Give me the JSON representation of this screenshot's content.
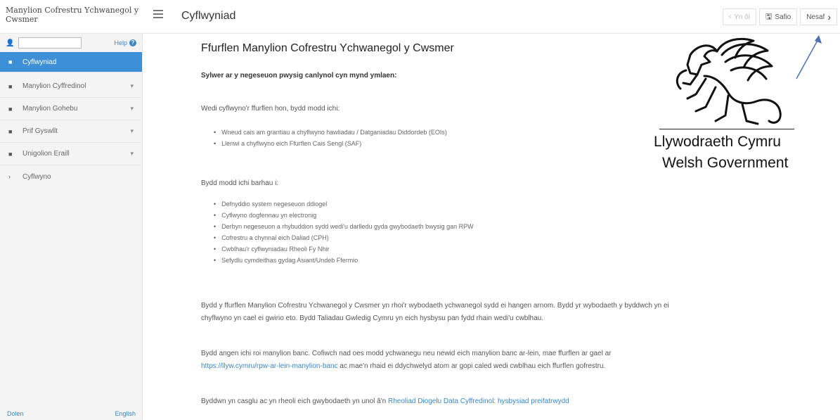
{
  "app": {
    "title": "Manylion Cofrestru Ychwanegol y Cwsmer",
    "page_heading": "Cyflwyniad"
  },
  "toolbar": {
    "prev_label": "Yn ôl",
    "save_label": "Safio",
    "next_label": "Nesaf"
  },
  "sidebar": {
    "user_value": "",
    "help_label": "Help",
    "items": [
      {
        "label": "Cyflwyniad",
        "icon": "file-icon",
        "active": true
      },
      {
        "label": "Manylion Cyffredinol",
        "icon": "file-icon",
        "expandable": true
      },
      {
        "label": "Manylion Gohebu",
        "icon": "file-icon",
        "expandable": true
      },
      {
        "label": "Prif Gyswllt",
        "icon": "file-icon",
        "expandable": true
      },
      {
        "label": "Unigolion Eraill",
        "icon": "file-icon",
        "expandable": true
      },
      {
        "label": "Cyflwyno",
        "icon": "chevron-right-icon"
      }
    ],
    "footer_left": "Dolen",
    "footer_right": "English"
  },
  "content": {
    "form_title": "Ffurflen Manylion Cofrestru Ychwanegol y Cwsmer",
    "notice": "Sylwer ar y negeseuon pwysig canlynol cyn mynd ymlaen:",
    "intro1": "Wedi cyflwyno'r ffurflen hon, bydd modd ichi:",
    "list1": [
      "Wneud cais am grantiau a chyflwyno hawliadau / Datganiadau Diddordeb (EOIs)",
      "Llenwi a chyflwyno eich Ffurflen Cais Sengl (SAF)"
    ],
    "intro2": "Bydd modd ichi barhau i:",
    "list2": [
      "Defnyddio system negeseuon ddiogel",
      "Cyflwyno dogfennau yn electronig",
      "Derbyn negeseuon a rhybuddion sydd wedi'u darlledu gyda gwybodaeth bwysig gan RPW",
      "Cofrestru a chynnal eich Daliad (CPH)",
      "Cwblhau'r cyflwyniadau Rheoli Fy Nhir",
      "Sefydlu cymdeithas gydag Asiant/Undeb Ffermio"
    ],
    "para1_line1": "Bydd y ffurflen Manylion Cofrestru Ychwanegol y Cwsmer yn rhoi'r wybodaeth ychwanegol sydd ei hangen arnom. Bydd yr wybodaeth y byddwch yn ei",
    "para1_line2": "chyflwyno yn cael ei gwirio eto. Bydd Taliadau Gwledig Cymru yn eich hysbysu pan fydd rhain wedi'u cwblhau.",
    "para2_line1": "Bydd angen ichi roi manylion banc. Cofiwch nad oes modd ychwanegu neu newid eich manylion banc ar-lein, mae ffurflen ar gael ar",
    "para2_link": "https://llyw.cymru/rpw-ar-lein-manylion-banc",
    "para2_line2_rest": " ac mae'n rhaid ei ddychwelyd atom ar gopi caled wedi cwblhau eich ffurflen gofrestru.",
    "para3_text": "Byddwn yn casglu ac yn rheoli eich gwybodaeth yn unol â'n ",
    "para3_link": "Rheoliad Diogelu Data Cyffredinol: hysbysiad preifatrwydd"
  },
  "logo": {
    "line_cy": "Llywodraeth Cymru",
    "line_en": "Welsh Government"
  },
  "colors": {
    "accent": "#3d8fd6",
    "link": "#3a87c8"
  }
}
